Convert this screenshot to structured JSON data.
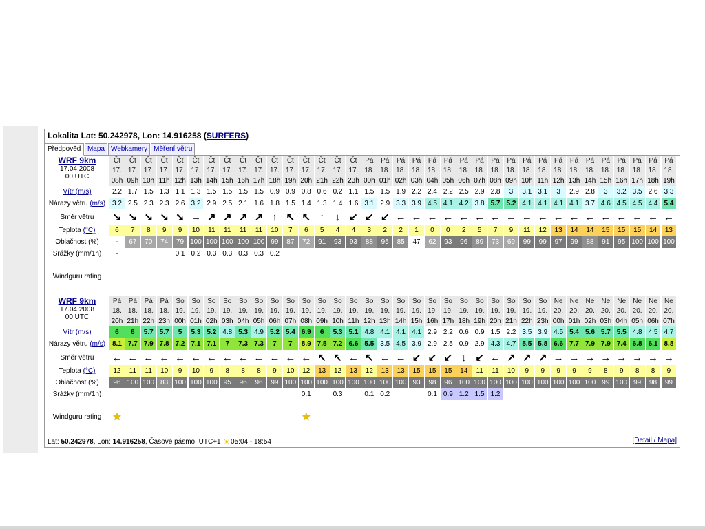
{
  "header": {
    "prefix": "Lokalita Lat: 50.242978, Lon: 14.916258  (",
    "link": "SURFERS",
    "suffix": ")"
  },
  "tabs": [
    "Předpověď",
    "Mapa",
    "Webkamery",
    "Měření větru"
  ],
  "labels": {
    "wind": "Vítr",
    "wind_unit": "(m/s)",
    "gusts": "Nárazy větru",
    "gusts_unit": "(m/s)",
    "dir": "Směr větru",
    "temp": "Teplota",
    "temp_unit": "(°C)",
    "cloud": "Oblačnost (%)",
    "precip": "Srážky (mm/1h)",
    "rating": "Windguru rating"
  },
  "blocks": [
    {
      "model": "WRF 9km",
      "date": "17.04.2008",
      "utc": "00 UTC",
      "days": [
        "Čt",
        "Čt",
        "Čt",
        "Čt",
        "Čt",
        "Čt",
        "Čt",
        "Čt",
        "Čt",
        "Čt",
        "Čt",
        "Čt",
        "Čt",
        "Čt",
        "Čt",
        "Čt",
        "Pá",
        "Pá",
        "Pá",
        "Pá",
        "Pá",
        "Pá",
        "Pá",
        "Pá",
        "Pá",
        "Pá",
        "Pá",
        "Pá",
        "Pá",
        "Pá",
        "Pá",
        "Pá",
        "Pá",
        "Pá",
        "Pá",
        "Pá"
      ],
      "dates": [
        "17.",
        "17.",
        "17.",
        "17.",
        "17.",
        "17.",
        "17.",
        "17.",
        "17.",
        "17.",
        "17.",
        "17.",
        "17.",
        "17.",
        "17.",
        "17.",
        "18.",
        "18.",
        "18.",
        "18.",
        "18.",
        "18.",
        "18.",
        "18.",
        "18.",
        "18.",
        "18.",
        "18.",
        "18.",
        "18.",
        "18.",
        "18.",
        "18.",
        "18.",
        "18.",
        "18."
      ],
      "hours": [
        "08h",
        "09h",
        "10h",
        "11h",
        "12h",
        "13h",
        "14h",
        "15h",
        "16h",
        "17h",
        "18h",
        "19h",
        "20h",
        "21h",
        "22h",
        "23h",
        "00h",
        "01h",
        "02h",
        "03h",
        "04h",
        "05h",
        "06h",
        "07h",
        "08h",
        "09h",
        "10h",
        "11h",
        "12h",
        "13h",
        "14h",
        "15h",
        "16h",
        "17h",
        "18h",
        "19h"
      ],
      "wind": [
        "2.2",
        "1.7",
        "1.5",
        "1.3",
        "1.1",
        "1.3",
        "1.5",
        "1.5",
        "1.5",
        "1.5",
        "0.9",
        "0.9",
        "0.8",
        "0.6",
        "0.2",
        "1.1",
        "1.5",
        "1.5",
        "1.9",
        "2.2",
        "2.4",
        "2.2",
        "2.5",
        "2.9",
        "2.8",
        "3",
        "3.1",
        "3.1",
        "3",
        "2.9",
        "2.8",
        "3",
        "3.2",
        "3.5",
        "2.6",
        "3.3"
      ],
      "gusts": [
        "3.2",
        "2.5",
        "2.3",
        "2.3",
        "2.6",
        "3.2",
        "2.9",
        "2.5",
        "2.1",
        "1.6",
        "1.8",
        "1.5",
        "1.4",
        "1.3",
        "1.4",
        "1.6",
        "3.1",
        "2.9",
        "3.3",
        "3.9",
        "4.5",
        "4.1",
        "4.2",
        "3.8",
        "5.7",
        "5.2",
        "4.1",
        "4.1",
        "4.1",
        "4.1",
        "3.7",
        "4.6",
        "4.5",
        "4.5",
        "4.4",
        "5.4"
      ],
      "dirs": [
        "↘",
        "↘",
        "↘",
        "↘",
        "➘",
        "→",
        "↗",
        "↗",
        "↗",
        "↗",
        "↑",
        "↖",
        "↖",
        "↑",
        "↓",
        "↙",
        "↙",
        "↙",
        "←",
        "←",
        "←",
        "←",
        "←",
        "←",
        "←",
        "←",
        "←",
        "←",
        "←",
        "←",
        "←",
        "←",
        "←",
        "←",
        "←",
        "←"
      ],
      "temp": [
        "6",
        "7",
        "8",
        "9",
        "9",
        "10",
        "11",
        "11",
        "11",
        "11",
        "10",
        "7",
        "6",
        "5",
        "4",
        "4",
        "3",
        "2",
        "2",
        "1",
        "0",
        "0",
        "2",
        "5",
        "7",
        "9",
        "11",
        "12",
        "13",
        "14",
        "14",
        "15",
        "15",
        "15",
        "14",
        "13"
      ],
      "cloud": [
        "-",
        "67",
        "70",
        "74",
        "79",
        "100",
        "100",
        "100",
        "100",
        "100",
        "99",
        "87",
        "72",
        "91",
        "93",
        "93",
        "88",
        "95",
        "85",
        "47",
        "62",
        "93",
        "96",
        "89",
        "73",
        "69",
        "99",
        "99",
        "97",
        "99",
        "88",
        "91",
        "95",
        "100",
        "100",
        "100"
      ],
      "precip": [
        "-",
        "",
        "",
        "",
        "0.1",
        "0.2",
        "0.3",
        "0.3",
        "0.3",
        "0.3",
        "0.2",
        "",
        "",
        "",
        "",
        "",
        "",
        "",
        "",
        "",
        "",
        "",
        "",
        "",
        "",
        "",
        "",
        "",
        "",
        "",
        "",
        "",
        "",
        "",
        "",
        ""
      ],
      "rating": []
    },
    {
      "model": "WRF 9km",
      "date": "17.04.2008",
      "utc": "00 UTC",
      "days": [
        "Pá",
        "Pá",
        "Pá",
        "Pá",
        "So",
        "So",
        "So",
        "So",
        "So",
        "So",
        "So",
        "So",
        "So",
        "So",
        "So",
        "So",
        "So",
        "So",
        "So",
        "So",
        "So",
        "So",
        "So",
        "So",
        "So",
        "So",
        "So",
        "So",
        "Ne",
        "Ne",
        "Ne",
        "Ne",
        "Ne",
        "Ne",
        "Ne",
        "Ne"
      ],
      "dates": [
        "18.",
        "18.",
        "18.",
        "18.",
        "19.",
        "19.",
        "19.",
        "19.",
        "19.",
        "19.",
        "19.",
        "19.",
        "19.",
        "19.",
        "19.",
        "19.",
        "19.",
        "19.",
        "19.",
        "19.",
        "19.",
        "19.",
        "19.",
        "19.",
        "19.",
        "19.",
        "19.",
        "19.",
        "20.",
        "20.",
        "20.",
        "20.",
        "20.",
        "20.",
        "20.",
        "20."
      ],
      "hours": [
        "20h",
        "21h",
        "22h",
        "23h",
        "00h",
        "01h",
        "02h",
        "03h",
        "04h",
        "05h",
        "06h",
        "07h",
        "08h",
        "09h",
        "10h",
        "11h",
        "12h",
        "13h",
        "14h",
        "15h",
        "16h",
        "17h",
        "18h",
        "19h",
        "20h",
        "21h",
        "22h",
        "23h",
        "00h",
        "01h",
        "02h",
        "03h",
        "04h",
        "05h",
        "06h",
        "07h"
      ],
      "wind": [
        "6",
        "6",
        "5.7",
        "5.7",
        "5",
        "5.3",
        "5.2",
        "4.8",
        "5.3",
        "4.9",
        "5.2",
        "5.4",
        "6.9",
        "6",
        "5.3",
        "5.1",
        "4.8",
        "4.1",
        "4.1",
        "4.1",
        "2.9",
        "2.2",
        "0.6",
        "0.9",
        "1.5",
        "2.2",
        "3.5",
        "3.9",
        "4.5",
        "5.4",
        "5.6",
        "5.7",
        "5.5",
        "4.8",
        "4.5",
        "4.7"
      ],
      "gusts": [
        "8.1",
        "7.7",
        "7.9",
        "7.8",
        "7.2",
        "7.1",
        "7.1",
        "7",
        "7.3",
        "7.3",
        "7",
        "7",
        "8.9",
        "7.5",
        "7.2",
        "6.6",
        "5.5",
        "3.5",
        "4.5",
        "3.9",
        "2.9",
        "2.5",
        "0.9",
        "2.9",
        "4.3",
        "4.7",
        "5.5",
        "5.8",
        "6.6",
        "7.7",
        "7.9",
        "7.9",
        "7.4",
        "6.8",
        "6.1",
        "8.8"
      ],
      "dirs": [
        "←",
        "←",
        "←",
        "←",
        "←",
        "←",
        "←",
        "←",
        "←",
        "←",
        "←",
        "←",
        "←",
        "↖",
        "↖",
        "←",
        "↖",
        "←",
        "←",
        "↙",
        "↙",
        "↙",
        "↓",
        "↙",
        "←",
        "↗",
        "↗",
        "↗",
        "→",
        "→",
        "→",
        "→",
        "→",
        "→",
        "→",
        "→"
      ],
      "temp": [
        "12",
        "11",
        "11",
        "10",
        "9",
        "10",
        "9",
        "8",
        "8",
        "8",
        "9",
        "10",
        "12",
        "13",
        "12",
        "13",
        "12",
        "13",
        "13",
        "15",
        "15",
        "15",
        "14",
        "11",
        "11",
        "10",
        "9",
        "9",
        "9",
        "9",
        "9",
        "8",
        "9",
        "8",
        "8",
        "9"
      ],
      "cloud": [
        "96",
        "100",
        "100",
        "83",
        "100",
        "100",
        "100",
        "95",
        "96",
        "96",
        "99",
        "100",
        "100",
        "100",
        "100",
        "100",
        "100",
        "100",
        "100",
        "93",
        "98",
        "96",
        "100",
        "100",
        "100",
        "100",
        "100",
        "100",
        "100",
        "100",
        "100",
        "99",
        "100",
        "99",
        "98",
        "99"
      ],
      "precip": [
        "",
        "",
        "",
        "",
        "",
        "",
        "",
        "",
        "",
        "",
        "",
        "",
        "0.1",
        "",
        "0.3",
        "",
        "0.1",
        "0.2",
        "",
        "",
        "0.1",
        "0.9",
        "1.2",
        "1.5",
        "1.2",
        "",
        "",
        "",
        "",
        "",
        "",
        "",
        "",
        "",
        "",
        ""
      ],
      "rating": [
        0,
        12
      ]
    }
  ],
  "footer": {
    "lat_label": "Lat:",
    "lat": "50.242978",
    "lon_label": ", Lon:",
    "lon": "14.916258",
    "tz": ", Časové pásmo: UTC+1",
    "sun": "05:04 - 18:54",
    "detail": "[Detail / Mapa]"
  }
}
